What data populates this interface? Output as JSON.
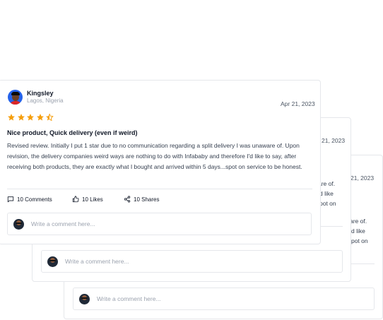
{
  "review": {
    "author": "Kingsley",
    "location": "Lagos, Nigeria",
    "date": "Apr 21, 2023",
    "rating": 4.5,
    "title": "Nice product, Quick delivery (even if weird)",
    "body": "Revised review. Initially I put 1 star due to no communication regarding a split delivery I was unaware of. Upon revision, the delivery companies weird ways are nothing to do with Infababy and therefore I'd like to say, after receiving both products, they are exactly what I bought and arrived within 5 days...spot on service to be honest.",
    "comments_label": "10 Comments",
    "likes_label": "10 Likes",
    "shares_label": "10 Shares",
    "comment_placeholder": "Write a comment here..."
  },
  "back1": {
    "date_fragment": "21, 2023",
    "text_fragments": [
      "are of.",
      "d like",
      "pot on"
    ],
    "comment_placeholder": "Write a comment here..."
  },
  "back2": {
    "date_fragment": "21, 2023",
    "text_fragments": [
      "are of.",
      "d like",
      "pot on"
    ],
    "comment_placeholder": "Write a comment here..."
  },
  "colors": {
    "star": "#f59e0b",
    "avatar_bg": "#2563eb",
    "border": "#e5e7eb"
  }
}
